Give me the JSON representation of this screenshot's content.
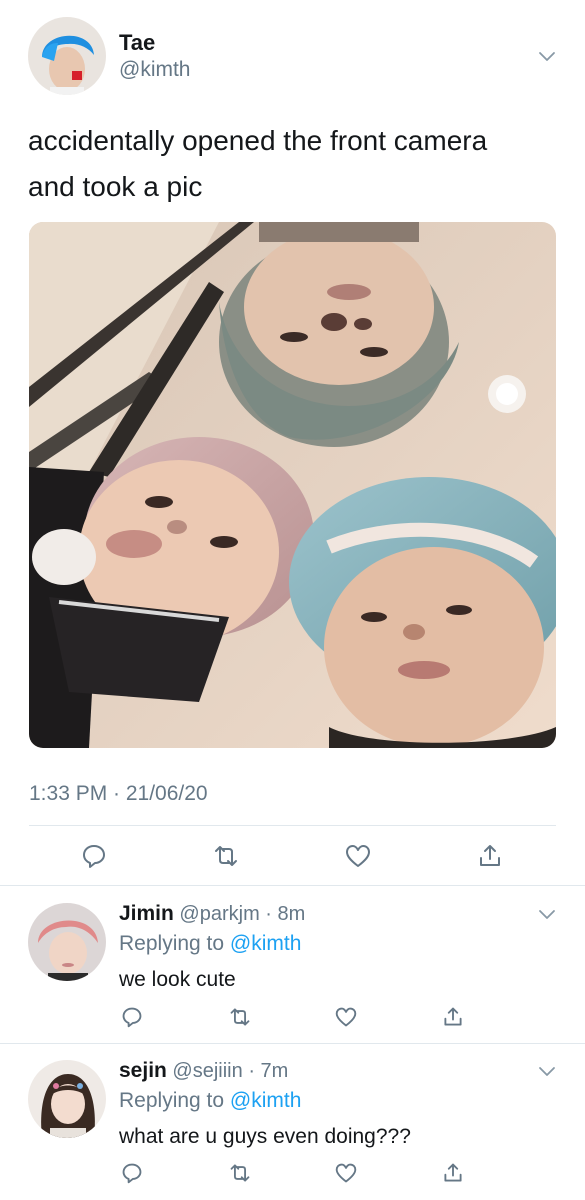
{
  "tweet": {
    "author_name": "Tae",
    "author_handle": "@kimth",
    "text_line1": "accidentally opened the front camera",
    "text_line2": "and took a pic",
    "timestamp": "1:33 PM · 21/06/20"
  },
  "actions": {
    "icons": [
      "reply-icon",
      "retweet-icon",
      "like-icon",
      "share-icon"
    ]
  },
  "replies": [
    {
      "name": "Jimin",
      "handle": "@parkjm",
      "time": "· 8m",
      "replying_prefix": "Replying to",
      "replying_to": "@kimth",
      "text": "we look cute"
    },
    {
      "name": "sejin",
      "handle": "@sejiiin",
      "time": "· 7m",
      "replying_prefix": "Replying to",
      "replying_to": "@kimth",
      "text": "what are u guys even doing???"
    }
  ],
  "colors": {
    "text": "#14171a",
    "secondary": "#657786",
    "link": "#1da1f2",
    "divider": "#e1e8ed",
    "icon": "#657786"
  }
}
